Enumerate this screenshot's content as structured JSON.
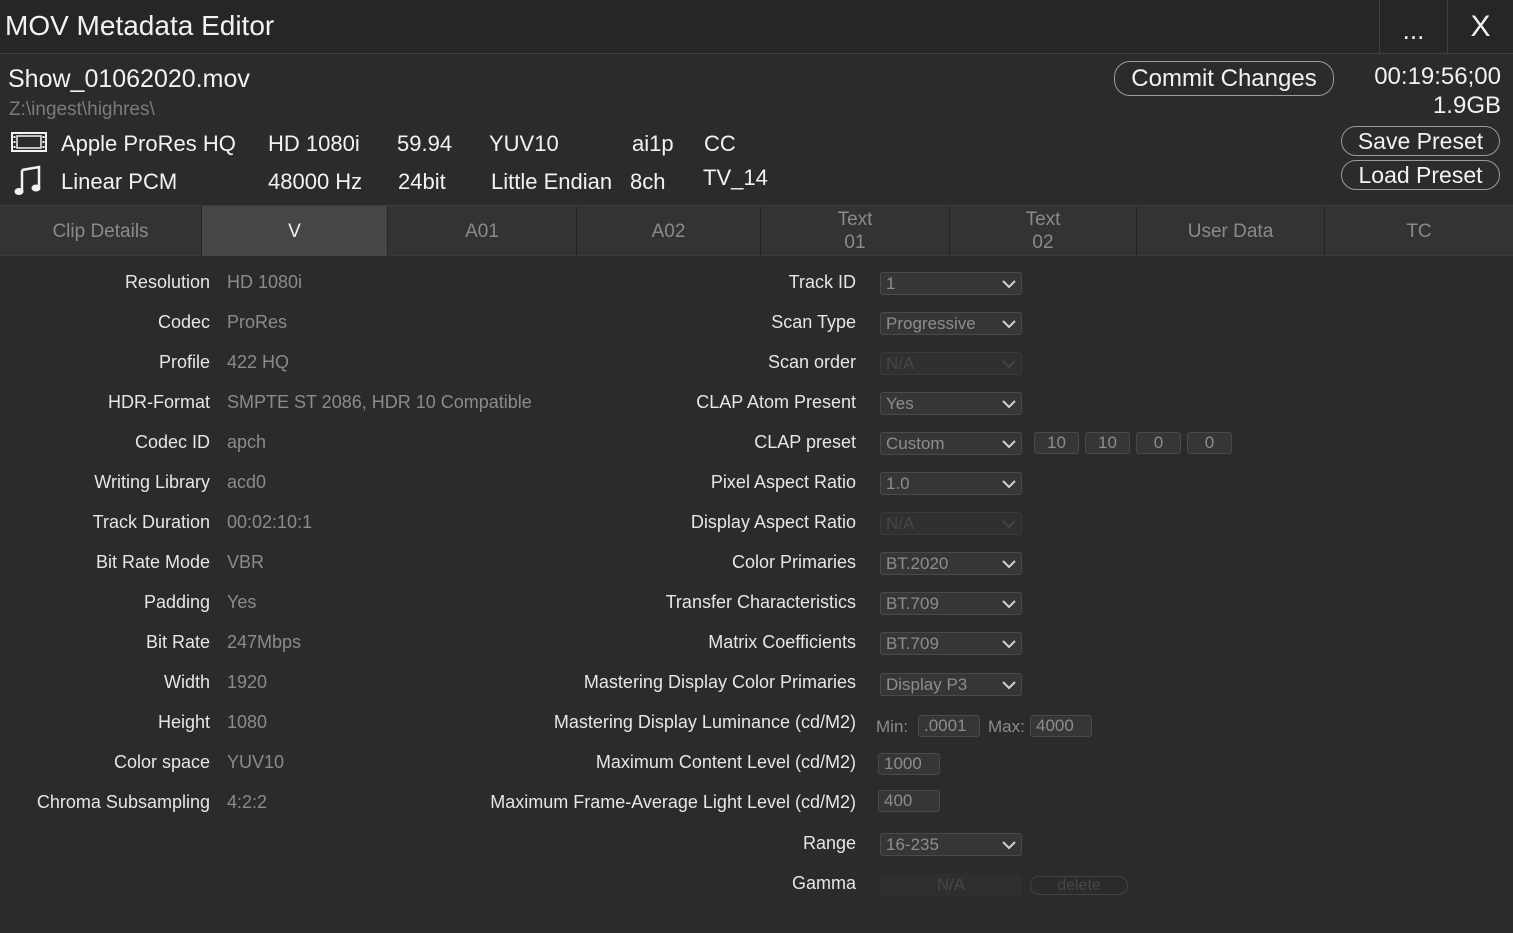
{
  "window": {
    "title": "MOV Metadata Editor",
    "more_label": "...",
    "close_label": "X"
  },
  "file": {
    "name": "Show_01062020.mov",
    "path": "Z:\\ingest\\highres\\",
    "timecode": "00:19:56;00",
    "size": "1.9GB"
  },
  "buttons": {
    "commit": "Commit Changes",
    "save_preset": "Save Preset",
    "load_preset": "Load Preset"
  },
  "video": {
    "icon": "film-icon",
    "codec": "Apple ProRes HQ",
    "format": "HD 1080i",
    "fps": "59.94",
    "color": "YUV10",
    "code": "ai1p",
    "cc": "CC"
  },
  "audio": {
    "icon": "music-note-icon",
    "codec": "Linear PCM",
    "rate": "48000 Hz",
    "bits": "24bit",
    "endian": "Little Endian",
    "channels": "8ch",
    "rating": "TV_14"
  },
  "tabs": [
    {
      "label": "Clip Details",
      "active": false
    },
    {
      "label": "V",
      "active": true
    },
    {
      "label": "A01",
      "active": false
    },
    {
      "label": "A02",
      "active": false
    },
    {
      "label": "Text\n01",
      "active": false
    },
    {
      "label": "Text\n02",
      "active": false
    },
    {
      "label": "User Data",
      "active": false
    },
    {
      "label": "TC",
      "active": false
    }
  ],
  "left_fields": [
    {
      "label": "Resolution",
      "value": "HD 1080i"
    },
    {
      "label": "Codec",
      "value": "ProRes"
    },
    {
      "label": "Profile",
      "value": "422 HQ"
    },
    {
      "label": "HDR-Format",
      "value": "SMPTE ST 2086, HDR 10 Compatible"
    },
    {
      "label": "Codec ID",
      "value": "apch"
    },
    {
      "label": "Writing Library",
      "value": "acd0"
    },
    {
      "label": "Track Duration",
      "value": "00:02:10:1"
    },
    {
      "label": "Bit Rate Mode",
      "value": "VBR"
    },
    {
      "label": "Padding",
      "value": "Yes"
    },
    {
      "label": "Bit Rate",
      "value": "247Mbps"
    },
    {
      "label": "Width",
      "value": "1920"
    },
    {
      "label": "Height",
      "value": "1080"
    },
    {
      "label": "Color space",
      "value": "YUV10"
    },
    {
      "label": "Chroma Subsampling",
      "value": "4:2:2"
    }
  ],
  "right_fields": {
    "track_id": {
      "label": "Track ID",
      "value": "1"
    },
    "scan_type": {
      "label": "Scan Type",
      "value": "Progressive"
    },
    "scan_order": {
      "label": "Scan order",
      "value": "N/A"
    },
    "clap_atom": {
      "label": "CLAP Atom Present",
      "value": "Yes"
    },
    "clap_preset": {
      "label": "CLAP preset",
      "value": "Custom",
      "boxes": [
        "10",
        "10",
        "0",
        "0"
      ]
    },
    "par": {
      "label": "Pixel Aspect Ratio",
      "value": "1.0"
    },
    "dar": {
      "label": "Display Aspect Ratio",
      "value": "N/A"
    },
    "primaries": {
      "label": "Color Primaries",
      "value": "BT.2020"
    },
    "transfer": {
      "label": "Transfer Characteristics",
      "value": "BT.709"
    },
    "matrix": {
      "label": "Matrix Coefficients",
      "value": "BT.709"
    },
    "md_primaries": {
      "label": "Mastering Display Color Primaries",
      "value": "Display P3"
    },
    "md_luminance": {
      "label": "Mastering Display Luminance (cd/M2)",
      "min_label": "Min:",
      "min": ".0001",
      "max_label": "Max:",
      "max": "4000"
    },
    "max_cll": {
      "label": "Maximum Content Level (cd/M2)",
      "value": "1000"
    },
    "max_fall": {
      "label": "Maximum Frame-Average Light Level (cd/M2)",
      "value": "400"
    },
    "range": {
      "label": "Range",
      "value": "16-235"
    },
    "gamma": {
      "label": "Gamma",
      "value": "N/A",
      "delete_label": "delete"
    }
  }
}
